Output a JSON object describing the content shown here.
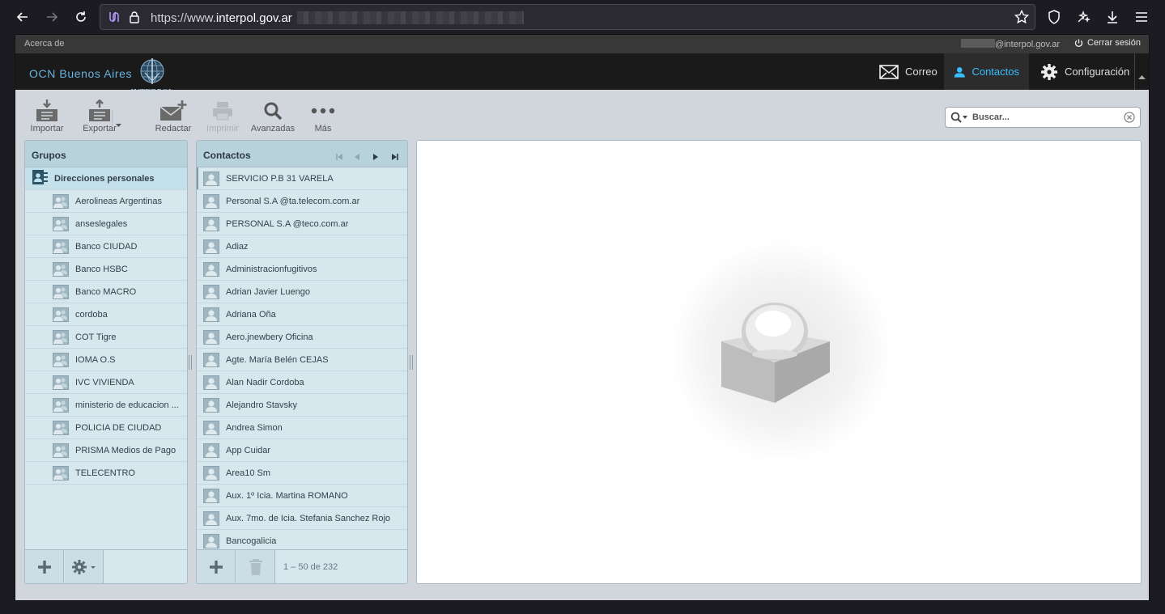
{
  "browser": {
    "url_prefix": "https://www.",
    "url_domain": "interpol.gov.ar"
  },
  "topline": {
    "about": "Acerca de",
    "user_email_suffix": "@interpol.gov.ar",
    "logout": "Cerrar sesión"
  },
  "header": {
    "brand": "OCN Buenos Aires",
    "logo_text": "INTERPOL",
    "tasks": [
      {
        "label": "Correo",
        "icon": "mail-icon"
      },
      {
        "label": "Contactos",
        "icon": "contacts-icon",
        "selected": true
      },
      {
        "label": "Configuración",
        "icon": "gear-icon"
      }
    ]
  },
  "toolbar": {
    "import": "Importar",
    "export": "Exportar",
    "compose": "Redactar",
    "print": "Imprimir",
    "advanced": "Avanzadas",
    "more": "Más",
    "search_placeholder": "Buscar..."
  },
  "groups": {
    "title": "Grupos",
    "personal": "Direcciones personales",
    "items": [
      "Aerolineas Argentinas",
      "anseslegales",
      "Banco CIUDAD",
      "Banco HSBC",
      "Banco MACRO",
      "cordoba",
      "COT Tigre",
      "IOMA O.S",
      "IVC VIVIENDA",
      "ministerio de educacion ...",
      "POLICIA DE CIUDAD",
      "PRISMA Medios de Pago",
      "TELECENTRO"
    ]
  },
  "contacts": {
    "title": "Contactos",
    "count": "1 – 50 de 232",
    "items": [
      "SERVICIO P.B 31 VARELA",
      "Personal S.A @ta.telecom.com.ar",
      "PERSONAL S.A @teco.com.ar",
      "Adiaz",
      "Administracionfugitivos",
      "Adrian Javier Luengo",
      "Adriana Oña",
      "Aero.jnewbery Oficina",
      "Agte. María Belén CEJAS",
      "Alan Nadir Cordoba",
      "Alejandro Stavsky",
      "Andrea Simon",
      "App Cuidar",
      "Area10 Sm",
      "Aux. 1º Icia. Martina ROMANO",
      "Aux. 7mo. de Icia. Stefania Sanchez Rojo",
      "Bancogalicia"
    ]
  },
  "colors": {
    "accent": "#37beff",
    "panel": "#d7e7ee",
    "panel_header": "#b8d2dc"
  }
}
